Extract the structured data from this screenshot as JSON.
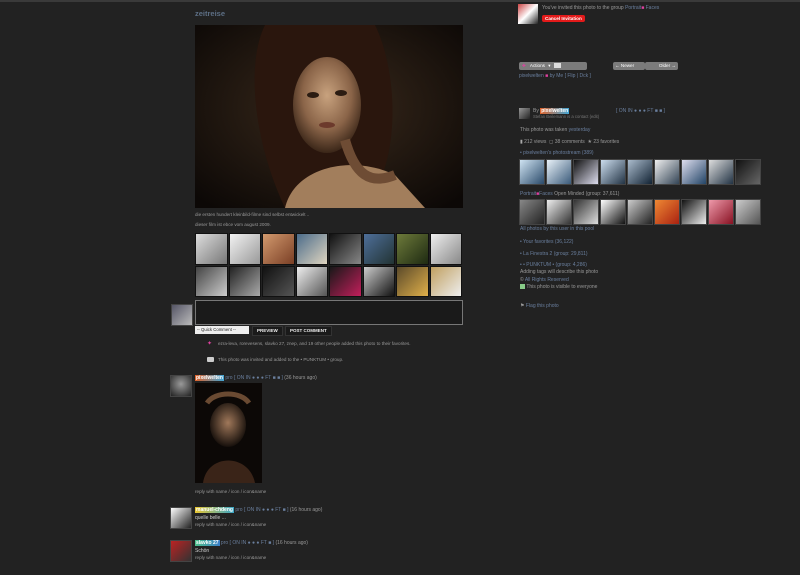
{
  "photo": {
    "title": "zeitreise",
    "description_1": "die ersten hundert kleinbild-filme sind selbst entwickelt ..",
    "description_2": "dieser film ist ebce vom august 2009."
  },
  "comment_form": {
    "quick_comment": "-- Quick Comment --",
    "preview": "PREVIEW",
    "post": "POST COMMENT"
  },
  "activity": {
    "favorites_line": "ezra-leva, rorevesens, slavko 27, znep, and 19 other people added this photo to their favorites.",
    "group_line": "This photo was invited and added to the • PUNKTUM • group."
  },
  "comments": [
    {
      "user": "pixelwelten",
      "suffix": "pro",
      "flags": "[ ON IN ● ● ● FT ■ ■ ]",
      "time": "(36 hours ago)",
      "text": "",
      "reply": "reply with name / icon / icon&name"
    },
    {
      "user": "manuel-chdeng",
      "suffix": "pro",
      "flags": "[ ON IN ● ● ● FT ■ ]",
      "time": "(16 hours ago)",
      "text": "quelle belle ...",
      "reply": "reply with name / icon / icon&name"
    },
    {
      "user": "slavko 27",
      "suffix": "pro",
      "flags": "[ ON IN ● ● ● FT ■ ]",
      "time": "(16 hours ago)",
      "text": "Schön",
      "reply": "reply with name / icon / icon&name"
    }
  ],
  "invite": {
    "text_prefix": "You've invited this photo to the group",
    "group": "Portrait",
    "group2": "Faces",
    "cancel": "Cancel Invitation"
  },
  "toolbar": {
    "actions": "Actions",
    "newer": "← Newer",
    "older": "Older →",
    "sub": "pixelwelten",
    "sub2": "by Me",
    "sub3": "[ Flip | Dck ]"
  },
  "owner": {
    "by": "By",
    "name": "pixelwelten",
    "sub": "Stefan Beilemann is a contact (edit)",
    "flags": "[ ON IN ● ● ● FT ■ ■ ]"
  },
  "stats": {
    "taken": "This photo was taken",
    "taken_link": "yesterday",
    "views": "212 views",
    "comments": "38 comments",
    "favorites": "23 favorites"
  },
  "context": {
    "photostream": "• pixelwelten's photostream (389)",
    "group": "Portrait",
    "group_rest": "Faces",
    "group_suffix": "Open Minded (group: 37,611)",
    "also": "All photos by this user in this pool",
    "fav": "• Your favorites (36,122)",
    "lafinestra": "• La Finestra 2 (group: 29,811)",
    "punktum": "• • PUNKTUM • (group: 4,286)",
    "tags": "Adding tags will describe this photo",
    "license": "All Rights Reserved",
    "visibility": "This photo is visible to everyone",
    "flag": "Flag this photo"
  }
}
